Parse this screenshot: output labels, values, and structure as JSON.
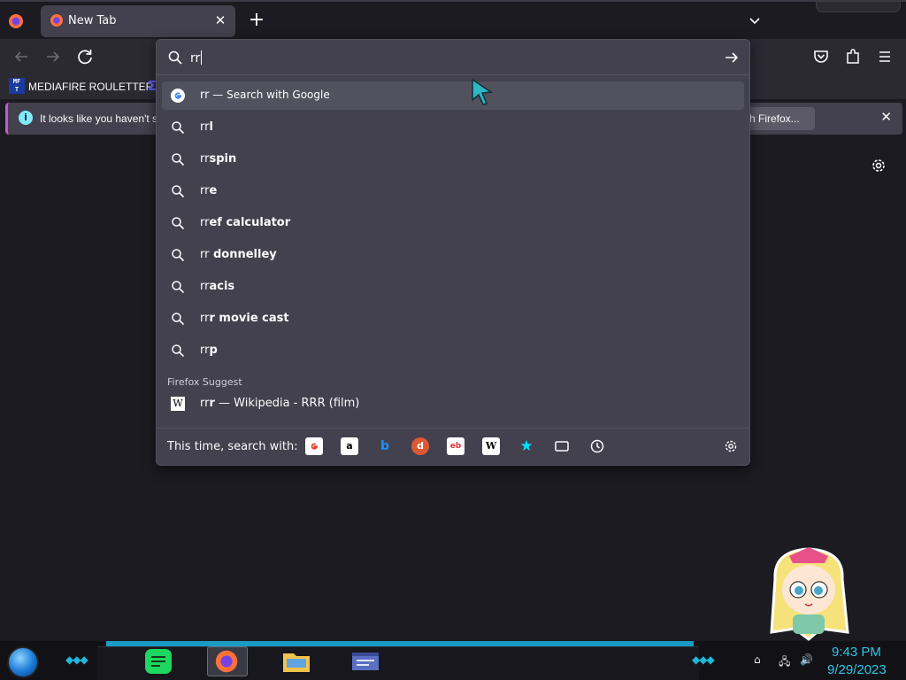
{
  "browser": {
    "tab": {
      "title": "New Tab",
      "close": "✕"
    },
    "new_tab": "+",
    "bookmarks": {
      "icon_text": "MF\nT",
      "label": "MEDIAFIRE ROULETTER",
      "next": "Σ"
    },
    "notification": {
      "text": "It looks like you haven't s",
      "button": "h Firefox...",
      "close": "✕",
      "info": "i"
    }
  },
  "urlbar": {
    "value": "rr",
    "rows": [
      {
        "typed": "rr",
        "rest": "",
        "action": " — Search with Google",
        "icon": "google-icon",
        "selected": true
      },
      {
        "typed": "rr",
        "rest": "l",
        "icon": "search-icon"
      },
      {
        "typed": "rr",
        "rest": "spin",
        "icon": "search-icon"
      },
      {
        "typed": "rr",
        "rest": "e",
        "icon": "search-icon"
      },
      {
        "typed": "rr",
        "rest": "ef calculator",
        "icon": "search-icon"
      },
      {
        "typed": "rr",
        "rest": " donnelley",
        "icon": "search-icon"
      },
      {
        "typed": "rr",
        "rest": "acis",
        "icon": "search-icon"
      },
      {
        "typed": "rr",
        "rest": "r movie cast",
        "icon": "search-icon"
      },
      {
        "typed": "rr",
        "rest": "p",
        "icon": "search-icon"
      }
    ],
    "group_label": "Firefox Suggest",
    "suggest": {
      "typed": "rr",
      "rest": "r",
      "suffix": " — Wikipedia - RRR (film)",
      "icon": "wikipedia-icon"
    },
    "one_off_label": "This time, search with:",
    "engines": [
      "google",
      "amazon",
      "bing",
      "duckduckgo",
      "ebay",
      "wikipedia",
      "bookmarks",
      "tabs",
      "history"
    ]
  },
  "taskbar": {
    "time": "9:43 PM",
    "date": "9/29/2023"
  },
  "colors": {
    "accent": "#1a9bc2",
    "clock": "#2ec5e6",
    "panel": "#42414d"
  }
}
